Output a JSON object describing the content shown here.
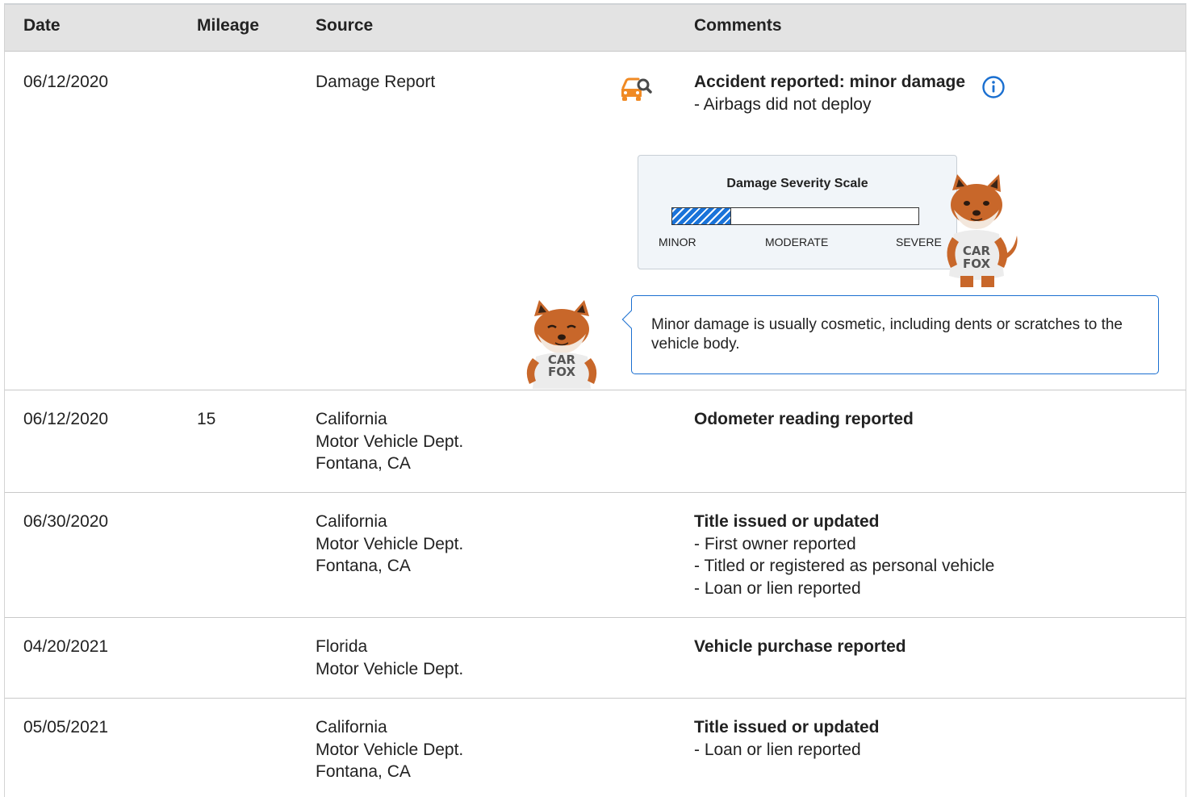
{
  "table": {
    "headers": {
      "date": "Date",
      "mileage": "Mileage",
      "source": "Source",
      "comments": "Comments"
    },
    "rows": [
      {
        "date": "06/12/2020",
        "mileage": "",
        "source": [
          "Damage Report"
        ],
        "comment_title": "Accident reported: minor damage",
        "details": [
          "- Airbags did not deploy"
        ]
      },
      {
        "date": "06/12/2020",
        "mileage": "15",
        "source": [
          "California",
          "Motor Vehicle Dept.",
          "Fontana, CA"
        ],
        "comment_title": "Odometer reading reported",
        "details": []
      },
      {
        "date": "06/30/2020",
        "mileage": "",
        "source": [
          "California",
          "Motor Vehicle Dept.",
          "Fontana, CA"
        ],
        "comment_title": "Title issued or updated",
        "details": [
          "- First owner reported",
          "- Titled or registered as personal vehicle",
          "- Loan or lien reported"
        ]
      },
      {
        "date": "04/20/2021",
        "mileage": "",
        "source": [
          "Florida",
          "Motor Vehicle Dept."
        ],
        "comment_title": "Vehicle purchase reported",
        "details": []
      },
      {
        "date": "05/05/2021",
        "mileage": "",
        "source": [
          "California",
          "Motor Vehicle Dept.",
          "Fontana, CA"
        ],
        "comment_title": "Title issued or updated",
        "details": [
          "- Loan or lien reported"
        ]
      }
    ]
  },
  "severity": {
    "title": "Damage Severity Scale",
    "labels": {
      "minor": "MINOR",
      "moderate": "MODERATE",
      "severe": "SEVERE"
    },
    "level_fraction": 0.24,
    "fill_color": "#1a73d9"
  },
  "tooltip": {
    "text": "Minor damage is usually cosmetic, including dents or scratches to the vehicle body."
  },
  "mascot": {
    "shirt_line1": "CAR",
    "shirt_line2": "FOX"
  },
  "icons": {
    "damage": "car-search-icon",
    "info": "info-icon"
  },
  "colors": {
    "header_bg": "#e3e3e3",
    "accent_blue": "#1a6fd0",
    "damage_orange": "#f08a24",
    "fox_orange": "#c8672a"
  }
}
